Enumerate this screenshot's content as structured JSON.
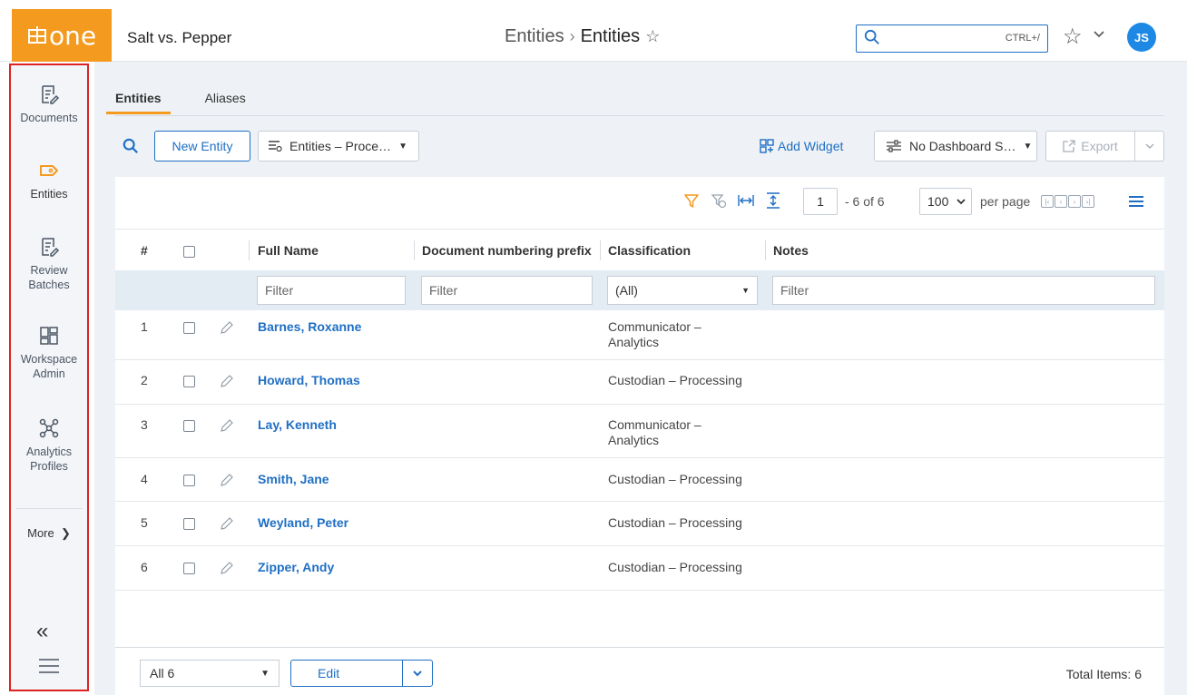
{
  "app": {
    "logo_text": "one",
    "workspace": "Salt vs. Pepper",
    "breadcrumb": {
      "parent": "Entities",
      "separator": "›",
      "current": "Entities"
    },
    "search": {
      "placeholder": "",
      "shortcut": "CTRL+/"
    },
    "user_initials": "JS",
    "accent_color": "#f39a1f",
    "link_color": "#1f6fc4"
  },
  "sidebar": {
    "items": [
      {
        "label": "Documents",
        "icon": "document-icon"
      },
      {
        "label": "Entities",
        "icon": "tag-icon"
      },
      {
        "label": "Review Batches",
        "icon": "document-icon"
      },
      {
        "label": "Workspace Admin",
        "icon": "grid-icon"
      },
      {
        "label": "Analytics Profiles",
        "icon": "network-icon"
      }
    ],
    "more_label": "More",
    "collapse_glyph": "«"
  },
  "tabs": [
    {
      "label": "Entities",
      "active": true
    },
    {
      "label": "Aliases",
      "active": false
    }
  ],
  "toolbar": {
    "new_entity": "New Entity",
    "view_select": "Entities – Proce…",
    "add_widget": "Add Widget",
    "dashboard_select": "No Dashboard S…",
    "export": "Export"
  },
  "pager": {
    "page": "1",
    "of_text": "- 6 of 6",
    "per_page_value": "100",
    "per_page_label": "per page"
  },
  "table": {
    "columns": [
      "#",
      "Full Name",
      "Document numbering prefix",
      "Classification",
      "Notes"
    ],
    "filters": {
      "full_name": "Filter",
      "prefix": "Filter",
      "classification": "(All)",
      "notes": "Filter"
    },
    "rows": [
      {
        "num": "1",
        "name": "Barnes, Roxanne",
        "classification": "Communicator – Analytics"
      },
      {
        "num": "2",
        "name": "Howard, Thomas",
        "classification": "Custodian – Processing"
      },
      {
        "num": "3",
        "name": "Lay, Kenneth",
        "classification": "Communicator – Analytics"
      },
      {
        "num": "4",
        "name": "Smith, Jane",
        "classification": "Custodian – Processing"
      },
      {
        "num": "5",
        "name": "Weyland, Peter",
        "classification": "Custodian – Processing"
      },
      {
        "num": "6",
        "name": "Zipper, Andy",
        "classification": "Custodian – Processing"
      }
    ]
  },
  "footer": {
    "select_value": "All 6",
    "edit_label": "Edit",
    "total_items": "Total Items: 6"
  }
}
